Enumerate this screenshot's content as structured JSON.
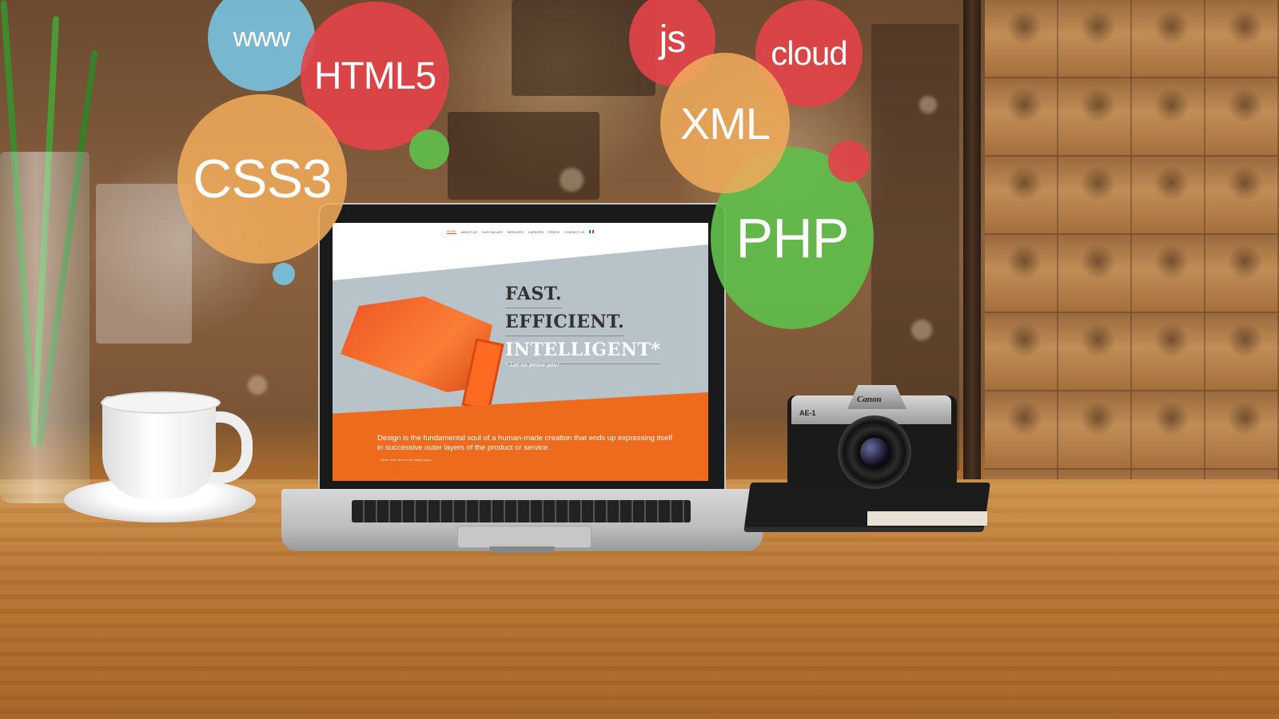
{
  "bubbles": {
    "www": "www",
    "html5": "HTML5",
    "css3": "CSS3",
    "js": "js",
    "cloud": "cloud",
    "xml": "XML",
    "php": "PHP"
  },
  "website": {
    "nav": [
      "HOME",
      "ABOUT US",
      "OUR VALUES",
      "SERVICES",
      "CAREERS",
      "PRESS",
      "CONTACT US"
    ],
    "headline": [
      "FAST.",
      "EFFICIENT.",
      "INTELLIGENT*"
    ],
    "tagline": "* Let us prove you!",
    "quote": "Design is the fundamental soul of a human-made creation that ends up expressing itself in successive outer layers of the product or service.",
    "quote_small": "Steve Jobs, And so we totally agree."
  },
  "camera": {
    "brand": "Canon",
    "model": "AE-1"
  },
  "colors": {
    "red": "#e24349",
    "orange": "#eeaa5a",
    "blue": "#78c3e1",
    "green": "#5fbe4b",
    "accent": "#ee6a1c"
  }
}
